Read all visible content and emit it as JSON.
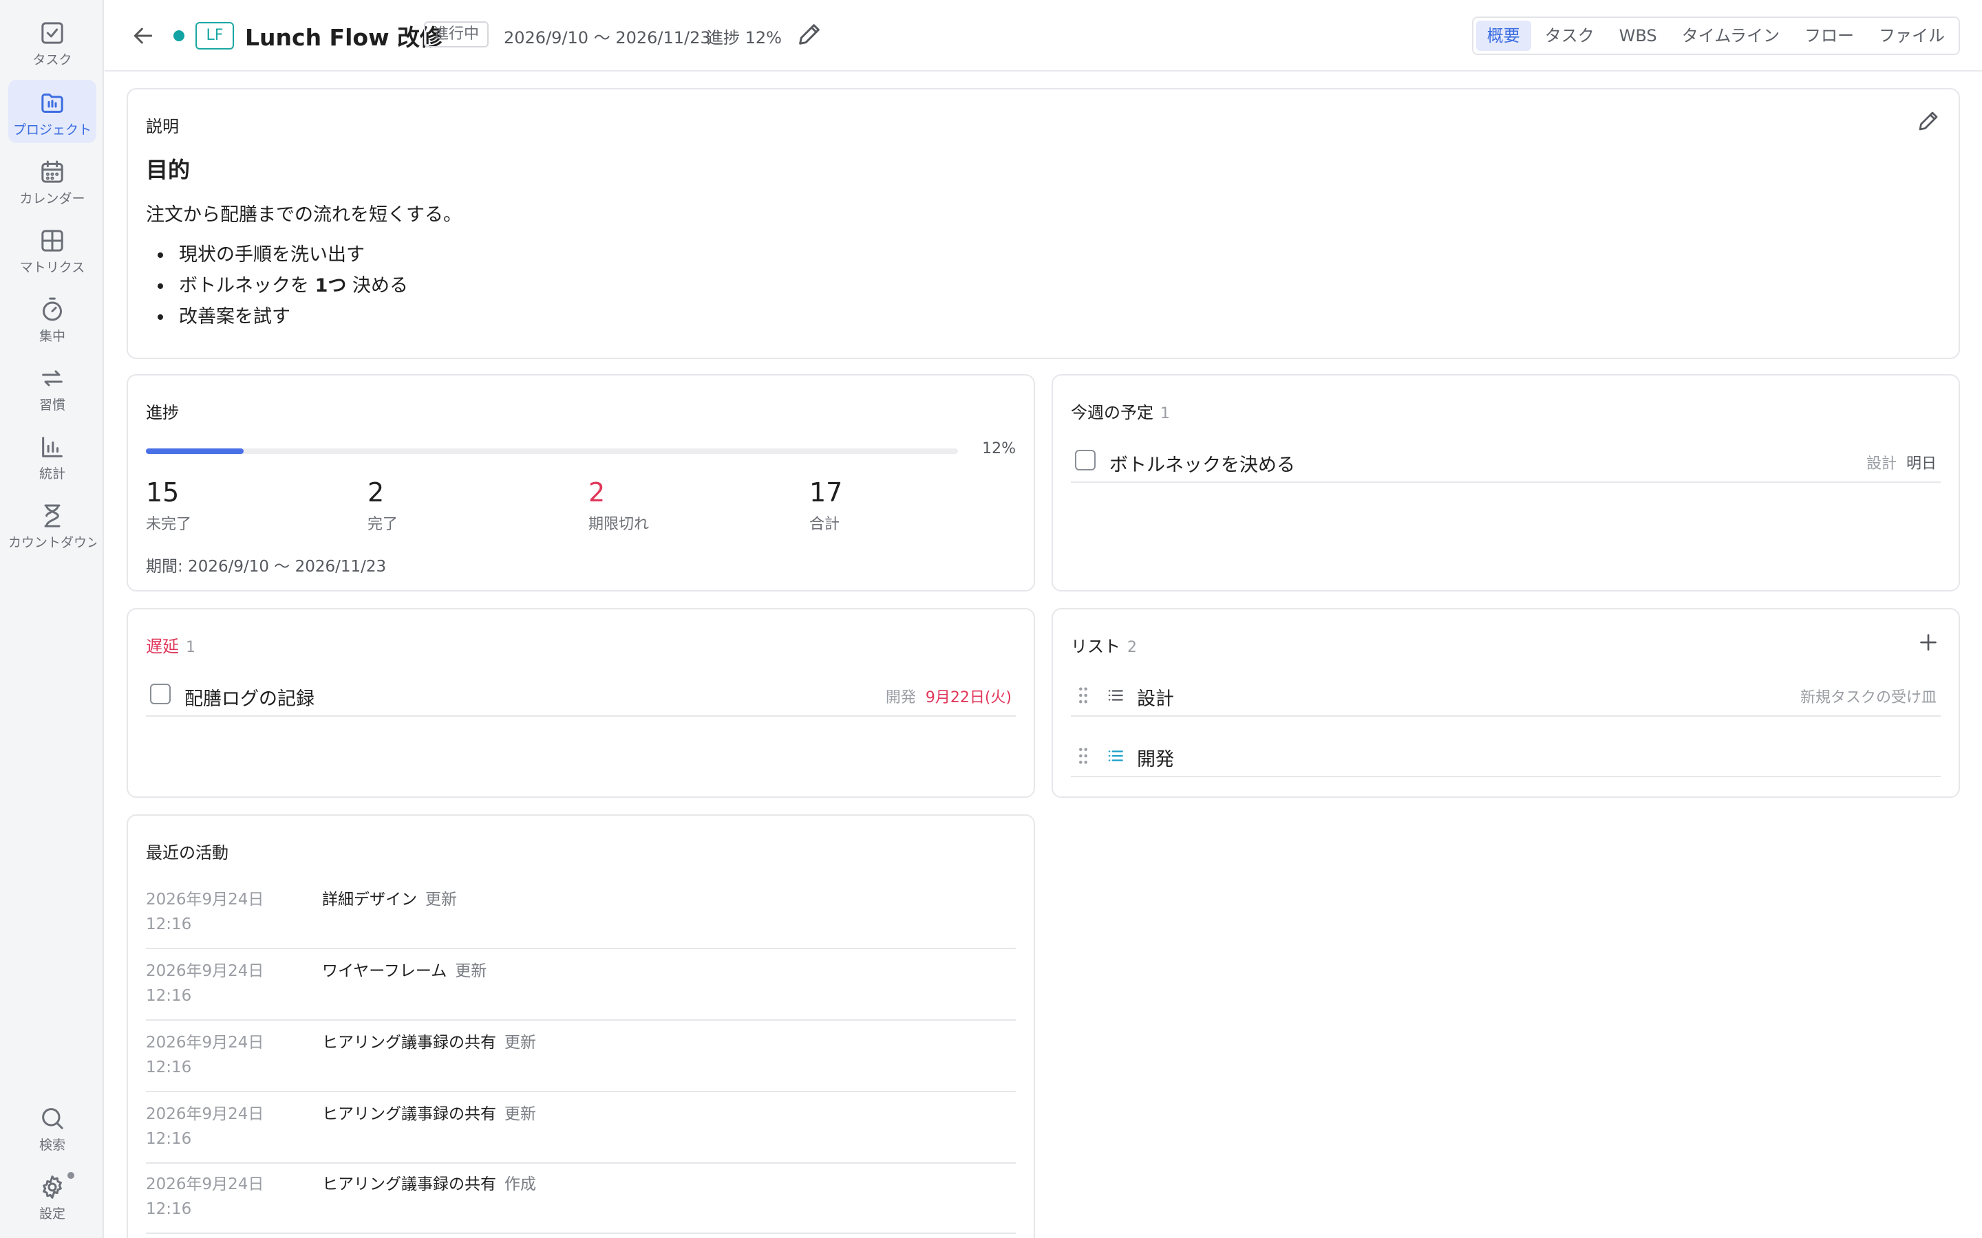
{
  "sidebar": {
    "items": [
      {
        "label": "タスク",
        "icon": "checkbox-icon"
      },
      {
        "label": "プロジェクト",
        "icon": "project-folder-icon"
      },
      {
        "label": "カレンダー",
        "icon": "calendar-icon"
      },
      {
        "label": "マトリクス",
        "icon": "matrix-icon"
      },
      {
        "label": "集中",
        "icon": "timer-icon"
      },
      {
        "label": "習慣",
        "icon": "repeat-icon"
      },
      {
        "label": "統計",
        "icon": "bar-chart-icon"
      },
      {
        "label": "カウントダウン",
        "icon": "hourglass-icon"
      }
    ],
    "bottom": [
      {
        "label": "検索",
        "icon": "search-icon"
      },
      {
        "label": "設定",
        "icon": "gear-icon"
      }
    ],
    "active_index": 1
  },
  "header": {
    "project_abbr": "LF",
    "project_name": "Lunch Flow 改修",
    "status": "進行中",
    "date_range": "2026/9/10 〜 2026/11/23",
    "progress": "進捗 12%",
    "tabs": [
      "概要",
      "タスク",
      "WBS",
      "タイムライン",
      "フロー",
      "ファイル"
    ],
    "active_tab": 0
  },
  "description": {
    "title": "説明",
    "heading": "目的",
    "body": "注文から配膳までの流れを短くする。",
    "bullets": [
      {
        "pre": "現状の手順を洗い出す",
        "bold": "",
        "post": ""
      },
      {
        "pre": "ボトルネックを ",
        "bold": "1つ",
        "post": " 決める"
      },
      {
        "pre": "改善案を試す",
        "bold": "",
        "post": ""
      }
    ]
  },
  "progress_card": {
    "title": "進捗",
    "percent": 12,
    "percent_label": "12%",
    "stats": [
      {
        "value": "15",
        "label": "未完了"
      },
      {
        "value": "2",
        "label": "完了"
      },
      {
        "value": "2",
        "label": "期限切れ"
      },
      {
        "value": "17",
        "label": "合計"
      }
    ],
    "period": "期間: 2026/9/10 〜 2026/11/23"
  },
  "week_card": {
    "title": "今週の予定",
    "count": "1",
    "tasks": [
      {
        "name": "ボトルネックを決める",
        "list": "設計",
        "due": "明日"
      }
    ]
  },
  "overdue_card": {
    "title": "遅延",
    "count": "1",
    "tasks": [
      {
        "name": "配膳ログの記録",
        "list": "開発",
        "due": "9月22日(火)"
      }
    ]
  },
  "list_card": {
    "title": "リスト",
    "count": "2",
    "lists": [
      {
        "name": "設計",
        "note": "新規タスクの受け皿",
        "color": "#55585e"
      },
      {
        "name": "開発",
        "note": "",
        "color": "#1aa0c8"
      }
    ]
  },
  "activity_card": {
    "title": "最近の活動",
    "items": [
      {
        "date": "2026年9月24日",
        "time": "12:16",
        "target": "詳細デザイン",
        "verb": "更新"
      },
      {
        "date": "2026年9月24日",
        "time": "12:16",
        "target": "ワイヤーフレーム",
        "verb": "更新"
      },
      {
        "date": "2026年9月24日",
        "time": "12:16",
        "target": "ヒアリング議事録の共有",
        "verb": "更新"
      },
      {
        "date": "2026年9月24日",
        "time": "12:16",
        "target": "ヒアリング議事録の共有",
        "verb": "更新"
      },
      {
        "date": "2026年9月24日",
        "time": "12:16",
        "target": "ヒアリング議事録の共有",
        "verb": "作成"
      }
    ]
  },
  "colors": {
    "accent": "#3b6ce0",
    "teal": "#1aa7a3",
    "danger": "#e0365a"
  }
}
